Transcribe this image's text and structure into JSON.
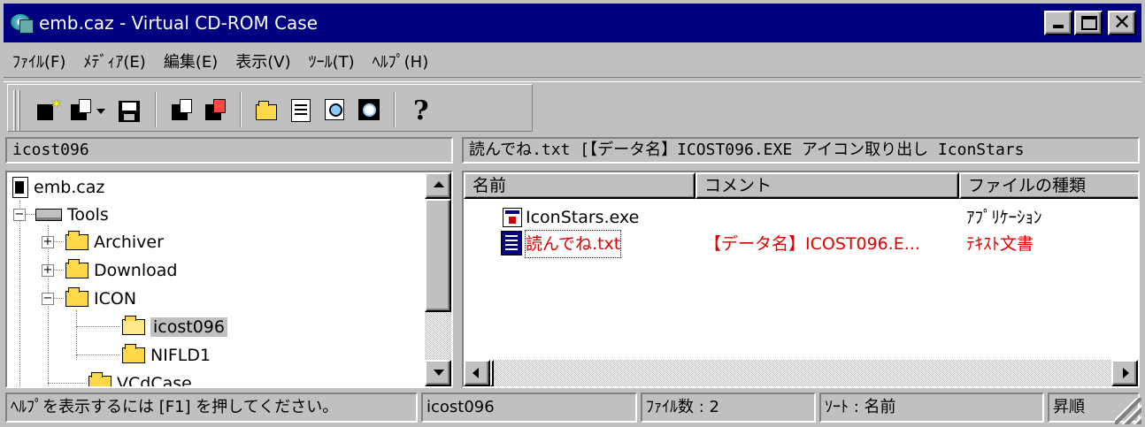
{
  "window": {
    "title": "emb.caz - Virtual CD-ROM Case",
    "buttons": {
      "minimize": "_",
      "maximize": "□",
      "close": "✕"
    }
  },
  "menu": [
    "ﾌｧｲﾙ(F)",
    "ﾒﾃﾞｨｱ(E)",
    "編集(E)",
    "表示(V)",
    "ﾂｰﾙ(T)",
    "ﾍﾙﾌﾟ(H)"
  ],
  "toolbar": {
    "icons": [
      "new-case-icon",
      "open-case-icon",
      "save-icon",
      "import-icon",
      "export-icon",
      "up-folder-icon",
      "properties-icon",
      "find-icon",
      "find-next-icon",
      "help-icon"
    ],
    "help_glyph": "?"
  },
  "left_path": "icost096",
  "right_path": "読んでね.txt [【データ名】ICOST096.EXE アイコン取り出し IconStars",
  "tree": {
    "root": "emb.caz",
    "nodes": [
      {
        "label": "Tools",
        "toggle": "−"
      },
      {
        "label": "Archiver",
        "toggle": "+"
      },
      {
        "label": "Download",
        "toggle": "+"
      },
      {
        "label": "ICON",
        "toggle": "−"
      },
      {
        "label": "icost096",
        "toggle": ""
      },
      {
        "label": "NIFLD1",
        "toggle": ""
      },
      {
        "label": "VCdCase",
        "toggle": ""
      }
    ]
  },
  "list": {
    "columns": [
      "名前",
      "コメント",
      "ファイルの種類"
    ],
    "rows": [
      {
        "name": "IconStars.exe",
        "comment": "",
        "type": "ｱﾌﾟﾘｹｰｼｮﾝ"
      },
      {
        "name": "読んでね.txt",
        "comment": "【データ名】ICOST096.E...",
        "type": "ﾃｷｽﾄ文書"
      }
    ]
  },
  "status": {
    "help": "ﾍﾙﾌﾟを表示するには [F1] を押してください。",
    "folder": "icost096",
    "file_count": "ﾌｧｲﾙ数 : 2",
    "sort": "ｿｰﾄ : 名前",
    "order": "昇順"
  },
  "colors": {
    "titlebar": "#000080",
    "face": "#c0c0c0",
    "highlight_text": "#e00000"
  }
}
